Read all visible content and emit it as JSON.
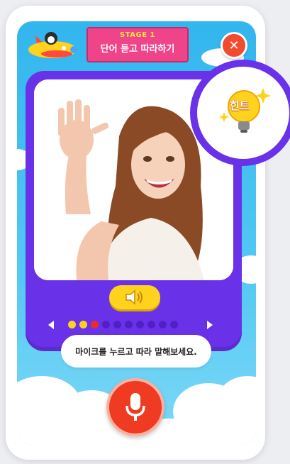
{
  "header": {
    "stage_label": "STAGE 1",
    "stage_title": "단어 듣고 따라하기"
  },
  "hint": {
    "label": "힌트"
  },
  "progress": {
    "total": 10,
    "current": 3,
    "completed": 2
  },
  "instruction": "마이크를 누르고 따라 말해보세요.",
  "colors": {
    "screen_bg": "#32b6ee",
    "card": "#6a32e8",
    "banner": "#f0448a",
    "close": "#f24b2e",
    "mic": "#ee3b22",
    "sound_button": "#ffd21e",
    "dot_completed": "#ffd21e",
    "dot_current": "#ee2b2b",
    "dot_pending": "#5120c4"
  },
  "icons": [
    "airplane-icon",
    "close-icon",
    "lightbulb-icon",
    "speaker-icon",
    "arrow-left-icon",
    "arrow-right-icon",
    "microphone-icon"
  ]
}
